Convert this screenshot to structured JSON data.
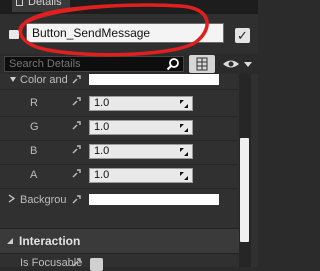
{
  "window": {
    "tab_label": "Details"
  },
  "name_row": {
    "widget_name": "Button_SendMessage",
    "is_variable_checked": true
  },
  "search": {
    "placeholder": "Search Details"
  },
  "properties": {
    "color_and_opacity_label": "Color and",
    "components": [
      {
        "label": "R",
        "value": "1.0"
      },
      {
        "label": "G",
        "value": "1.0"
      },
      {
        "label": "B",
        "value": "1.0"
      },
      {
        "label": "A",
        "value": "1.0"
      }
    ],
    "background_label": "Backgrou",
    "background_color": "#ffffff"
  },
  "sections": {
    "interaction": "Interaction",
    "is_focusable_label": "Is Focusable",
    "is_focusable_checked": true
  },
  "colors": {
    "annotation": "#e02020",
    "panel_bg": "#303030",
    "field_bg": "#e9e9e9"
  }
}
